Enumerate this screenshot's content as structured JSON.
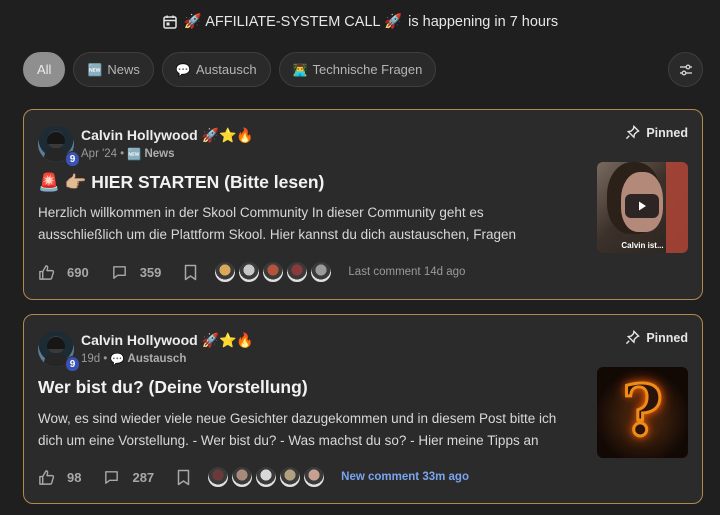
{
  "event_bar": {
    "prefix": "🚀 AFFILIATE-SYSTEM CALL 🚀",
    "suffix": "is happening in 7 hours",
    "icon": "calendar-icon"
  },
  "filters": [
    {
      "label": "All",
      "emoji": "",
      "active": true
    },
    {
      "label": "News",
      "emoji": "🆕",
      "active": false
    },
    {
      "label": "Austausch",
      "emoji": "💬",
      "active": false
    },
    {
      "label": "Technische Fragen",
      "emoji": "👨‍💻",
      "active": false
    }
  ],
  "posts": [
    {
      "author": "Calvin Hollywood 🚀⭐🔥",
      "level": "9",
      "date": "Apr '24",
      "separator": "•",
      "category_emoji": "🆕",
      "category": "News",
      "pinned_label": "Pinned",
      "title": "🚨 👉🏼 HIER STARTEN (Bitte lesen)",
      "body_line1": "Herzlich willkommen in der Skool Community In dieser Community geht es",
      "body_line2": "ausschließlich um die Plattform Skool. Hier kannst du dich austauschen, Fragen",
      "likes": "690",
      "comments": "359",
      "last_comment": "Last comment 14d ago",
      "thumbnail_caption": "Calvin ist...",
      "commenter_colors": [
        "#d9a85a",
        "#c8c8c8",
        "#b5533a",
        "#8a3a3a",
        "#9a9a9a"
      ]
    },
    {
      "author": "Calvin Hollywood 🚀⭐🔥",
      "level": "9",
      "date": "19d",
      "separator": "•",
      "category_emoji": "💬",
      "category": "Austausch",
      "pinned_label": "Pinned",
      "title": "Wer bist du? (Deine Vorstellung)",
      "body_line1": "Wow, es sind wieder viele neue Gesichter dazugekommen und in diesem Post bitte ich",
      "body_line2": "dich um eine Vorstellung. - Wer bist du? - Was machst du so? - Hier meine Tipps an",
      "likes": "98",
      "comments": "287",
      "last_comment": "New comment 33m ago",
      "thumbnail_caption": "?",
      "commenter_colors": [
        "#6a3a3a",
        "#a88a7a",
        "#d8d8d8",
        "#b0a080",
        "#c8a090"
      ]
    }
  ]
}
